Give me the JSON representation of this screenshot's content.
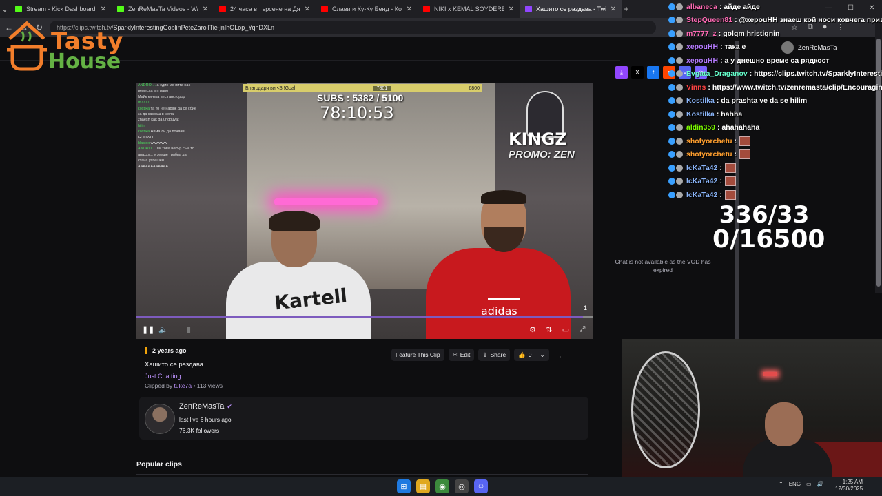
{
  "browser": {
    "tabs": [
      {
        "label": "Stream - Kick Dashboard",
        "fav_color": "#53fc18",
        "active": false
      },
      {
        "label": "ZenReMasTa Videos - Watch O",
        "fav_color": "#53fc18",
        "active": false
      },
      {
        "label": "24 часа в търсене на Дяволск",
        "fav_color": "#ff0000",
        "active": false
      },
      {
        "label": "Слави и Ку-Ку Бенд - Кой уши",
        "fav_color": "#ff0000",
        "active": false
      },
      {
        "label": "NIKI x KEMAL SOYDERE PARITE",
        "fav_color": "#ff0000",
        "active": false
      },
      {
        "label": "Хашито се раздава - Twitc",
        "fav_color": "#9146ff",
        "active": true
      }
    ],
    "url_domain": "https://clips.twitch.tv/",
    "url_path": "SparklyInterestingGoblinPeteZarollTie-jnIhOLop_YqhDXLn"
  },
  "logo": {
    "line1": "Tasty",
    "line2": "House"
  },
  "video": {
    "subs_label": "SUBS : 5382 / 5100",
    "timer": "78:10:53",
    "goal_left": "Благодаря ви <3 !Goal",
    "goal_mid": "7801",
    "goal_right": "6800",
    "kingz": "KINGZ",
    "promo": "PROMO: ZEN",
    "shirt_brand": "Kartell",
    "hoodie_brand": "adidas",
    "counter_corner": "1",
    "overlay_chat": [
      {
        "user": "ANDRO....",
        "text": "а един ме пита нас"
      },
      {
        "user": "",
        "text": "ремесса в п рапо"
      },
      {
        "user": "",
        "text": "Майк кинзка вес гансторор"
      },
      {
        "user": "m7777",
        "text": ""
      },
      {
        "user": "kostika",
        "text": "та то не нараж да се сбие"
      },
      {
        "user": "",
        "text": "за да казваш в жопа"
      },
      {
        "user": "",
        "text": "znaesh kak da ungpuvat"
      },
      {
        "user": "hilim",
        "text": ""
      },
      {
        "user": "kostika",
        "text": "Няма ли да почваш"
      },
      {
        "user": "",
        "text": "GOOWO"
      },
      {
        "user": "blastxx",
        "text": "wwwwww"
      },
      {
        "user": "ANDRO....",
        "text": "ли това некър съм то"
      },
      {
        "user": "",
        "text": "апаххх... у зееше трябва да"
      },
      {
        "user": "",
        "text": "стана успешен"
      },
      {
        "user": "",
        "text": "AAAAAAAAAAAA"
      }
    ]
  },
  "clip": {
    "ago": "2 years ago",
    "title": "Хашито се раздава",
    "category": "Just Chatting",
    "clipped_by_prefix": "Clipped by",
    "clipped_by_user": "tuke7a",
    "views": "• 113 views",
    "feature_label": "Feature This Clip",
    "edit_label": "Edit",
    "share_label": "Share",
    "like_count": "0"
  },
  "channel": {
    "name": "ZenReMasTa",
    "last_live": "last live 6 hours ago",
    "followers": "76.3K followers"
  },
  "popular_clips": "Popular clips",
  "side": {
    "chat_unavailable": "Chat is not available as the VOD has expired",
    "account_name": "ZenReMasTa"
  },
  "stream_chat": [
    {
      "user": "albaneca",
      "color": "#ff69b4",
      "text": ": айде айде",
      "emote": false
    },
    {
      "user": "StepQueen81",
      "color": "#ff69b4",
      "text": ": @херouHH знаеш кой носи ковчега приз",
      "emote": false
    },
    {
      "user": "m7777_z",
      "color": "#ff69b4",
      "text": ": golqm hristiqnin",
      "emote": false
    },
    {
      "user": "хepouHH",
      "color": "#b57bff",
      "text": ": така е",
      "emote": false
    },
    {
      "user": "хepouHH",
      "color": "#b57bff",
      "text": ": а у днешно време са рядкост",
      "emote": false
    },
    {
      "user": "Evgata_Draganov",
      "color": "#66ffcc",
      "text": ": https://clips.twitch.tv/SparklyInteresti",
      "emote": false
    },
    {
      "user": "Vinns",
      "color": "#ff4444",
      "text": ": https://www.twitch.tv/zenremasta/clip/EncouragingSe",
      "emote": false
    },
    {
      "user": "Kostilka",
      "color": "#8ab4f8",
      "text": ": da prashta ve da se hilim",
      "emote": false
    },
    {
      "user": "Kostilka",
      "color": "#8ab4f8",
      "text": ": hahha",
      "emote": false
    },
    {
      "user": "aldin359",
      "color": "#7cfc00",
      "text": ": ahahahaha",
      "emote": false
    },
    {
      "user": "shofyorchetu",
      "color": "#ff9f2f",
      "text": ":",
      "emote": true
    },
    {
      "user": "shofyorchetu",
      "color": "#ff9f2f",
      "text": ":",
      "emote": true
    },
    {
      "user": "IcKaTa42",
      "color": "#8ab4f8",
      "text": ":",
      "emote": true
    },
    {
      "user": "IcKaTa42",
      "color": "#8ab4f8",
      "text": ":",
      "emote": true
    },
    {
      "user": "IcKaTa42",
      "color": "#8ab4f8",
      "text": ":",
      "emote": true
    }
  ],
  "counter": {
    "line1": "336/33",
    "line2": "0/16500"
  },
  "taskbar": {
    "lang": "ENG",
    "time": "1:25 AM",
    "date": "12/30/2025"
  }
}
